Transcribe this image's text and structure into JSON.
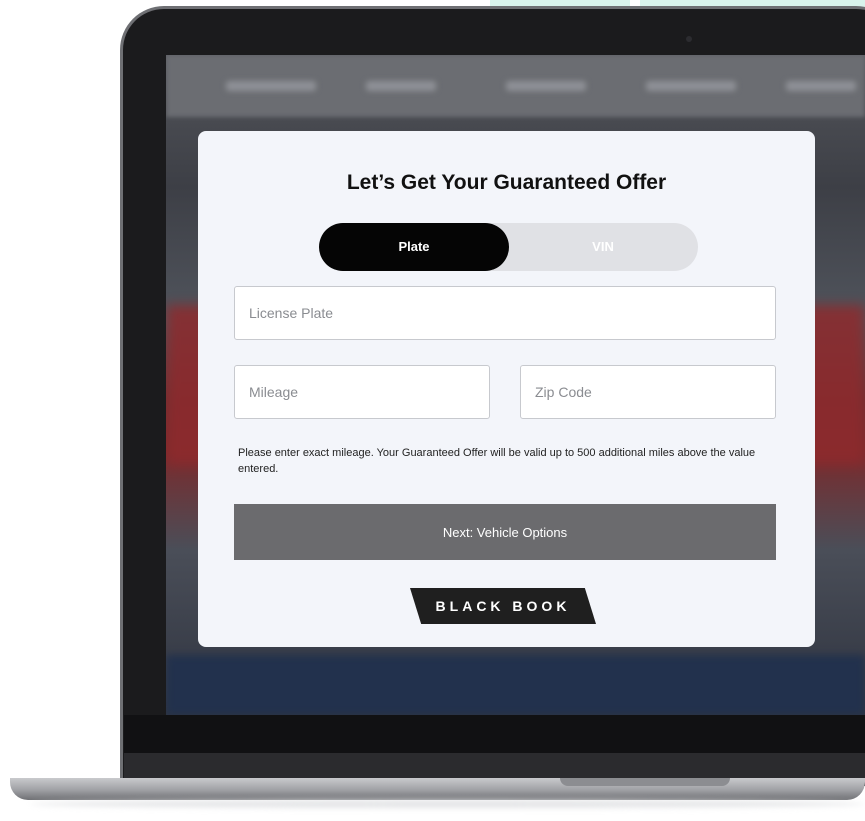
{
  "modal": {
    "title": "Let’s Get Your Guaranteed Offer",
    "toggle": {
      "options": [
        "Plate",
        "VIN"
      ],
      "selected": "Plate"
    },
    "fields": {
      "license_plate": {
        "placeholder": "License Plate",
        "value": ""
      },
      "mileage": {
        "placeholder": "Mileage",
        "value": ""
      },
      "zip_code": {
        "placeholder": "Zip Code",
        "value": ""
      }
    },
    "hint": "Please enter exact mileage. Your Guaranteed Offer will be valid up to 500 additional miles above the value entered.",
    "next_button": "Next: Vehicle Options",
    "logo_text": "BLACK BOOK"
  },
  "colors": {
    "card_bg": "#f3f5fa",
    "toggle_active": "#050505",
    "toggle_track": "#e0e1e5",
    "button_bg": "#6b6b6e",
    "logo_bg": "#1f1f1f"
  }
}
